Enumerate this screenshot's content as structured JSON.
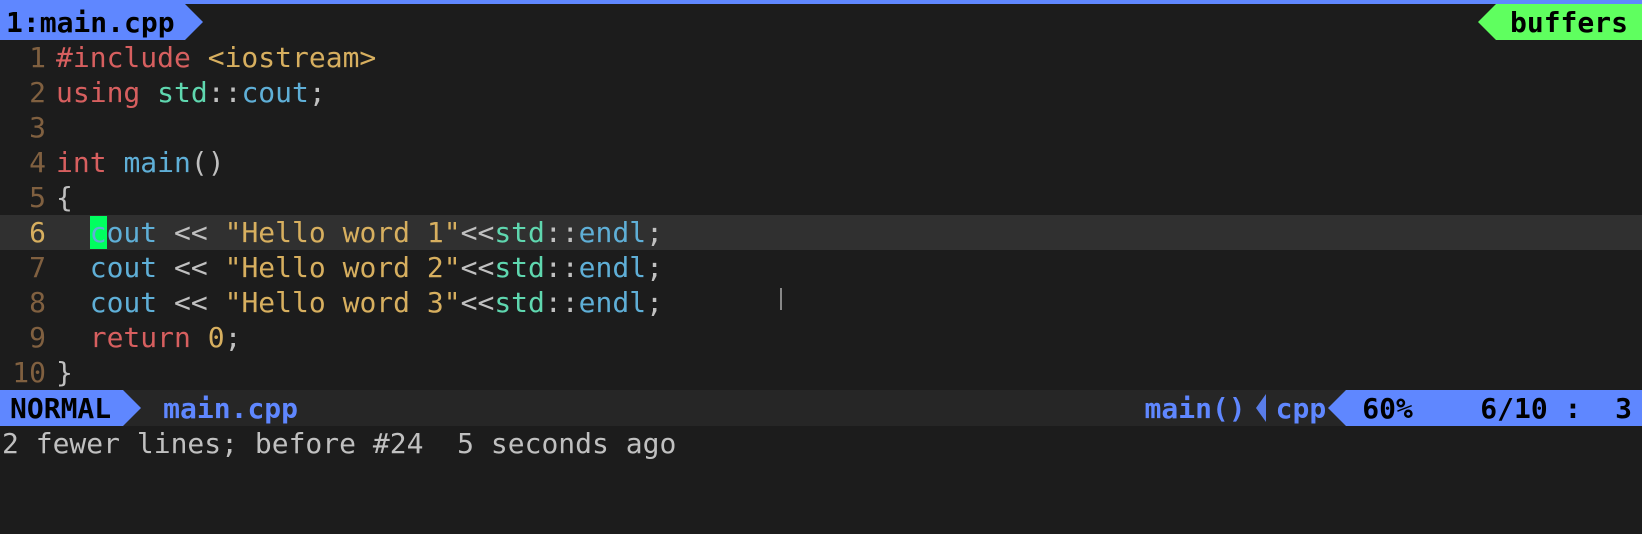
{
  "tab": {
    "index": "1",
    "sep": ": ",
    "name": "main.cpp"
  },
  "buffers_label": "buffers",
  "code_lines": [
    {
      "num": "1",
      "tokens": [
        {
          "cls": "kw-red",
          "t": "#include"
        },
        {
          "cls": "plain",
          "t": " "
        },
        {
          "cls": "str",
          "t": "<iostream>"
        }
      ]
    },
    {
      "num": "2",
      "tokens": [
        {
          "cls": "kw-red",
          "t": "using"
        },
        {
          "cls": "plain",
          "t": " "
        },
        {
          "cls": "type",
          "t": "std"
        },
        {
          "cls": "op",
          "t": "::"
        },
        {
          "cls": "func",
          "t": "cout"
        },
        {
          "cls": "op",
          "t": ";"
        }
      ]
    },
    {
      "num": "3",
      "tokens": []
    },
    {
      "num": "4",
      "tokens": [
        {
          "cls": "kw-red",
          "t": "int"
        },
        {
          "cls": "plain",
          "t": " "
        },
        {
          "cls": "func",
          "t": "main"
        },
        {
          "cls": "op",
          "t": "()"
        }
      ]
    },
    {
      "num": "5",
      "tokens": [
        {
          "cls": "op",
          "t": "{"
        }
      ]
    },
    {
      "num": "6",
      "current": true,
      "tokens": [
        {
          "cls": "plain",
          "t": "  "
        },
        {
          "cls": "func",
          "t": "c",
          "cursor": true
        },
        {
          "cls": "func",
          "t": "out"
        },
        {
          "cls": "plain",
          "t": " "
        },
        {
          "cls": "op",
          "t": "<<"
        },
        {
          "cls": "plain",
          "t": " "
        },
        {
          "cls": "str",
          "t": "\"Hello word 1\""
        },
        {
          "cls": "op",
          "t": "<<"
        },
        {
          "cls": "type",
          "t": "std"
        },
        {
          "cls": "op",
          "t": "::"
        },
        {
          "cls": "func",
          "t": "endl"
        },
        {
          "cls": "op",
          "t": ";"
        }
      ]
    },
    {
      "num": "7",
      "tokens": [
        {
          "cls": "plain",
          "t": "  "
        },
        {
          "cls": "func",
          "t": "cout"
        },
        {
          "cls": "plain",
          "t": " "
        },
        {
          "cls": "op",
          "t": "<<"
        },
        {
          "cls": "plain",
          "t": " "
        },
        {
          "cls": "str",
          "t": "\"Hello word 2\""
        },
        {
          "cls": "op",
          "t": "<<"
        },
        {
          "cls": "type",
          "t": "std"
        },
        {
          "cls": "op",
          "t": "::"
        },
        {
          "cls": "func",
          "t": "endl"
        },
        {
          "cls": "op",
          "t": ";"
        }
      ]
    },
    {
      "num": "8",
      "tokens": [
        {
          "cls": "plain",
          "t": "  "
        },
        {
          "cls": "func",
          "t": "cout"
        },
        {
          "cls": "plain",
          "t": " "
        },
        {
          "cls": "op",
          "t": "<<"
        },
        {
          "cls": "plain",
          "t": " "
        },
        {
          "cls": "str",
          "t": "\"Hello word 3\""
        },
        {
          "cls": "op",
          "t": "<<"
        },
        {
          "cls": "type",
          "t": "std"
        },
        {
          "cls": "op",
          "t": "::"
        },
        {
          "cls": "func",
          "t": "endl"
        },
        {
          "cls": "op",
          "t": ";"
        }
      ]
    },
    {
      "num": "9",
      "tokens": [
        {
          "cls": "plain",
          "t": "  "
        },
        {
          "cls": "kw-red",
          "t": "return"
        },
        {
          "cls": "plain",
          "t": " "
        },
        {
          "cls": "str",
          "t": "0"
        },
        {
          "cls": "op",
          "t": ";"
        }
      ]
    },
    {
      "num": "10",
      "tokens": [
        {
          "cls": "op",
          "t": "}"
        }
      ]
    }
  ],
  "status": {
    "mode": "NORMAL",
    "file": "main.cpp",
    "context": "main()",
    "filetype": "cpp",
    "percent": "60%",
    "line": "6",
    "total": "10",
    "col": "3"
  },
  "cmdline": "2 fewer lines; before #24  5 seconds ago"
}
